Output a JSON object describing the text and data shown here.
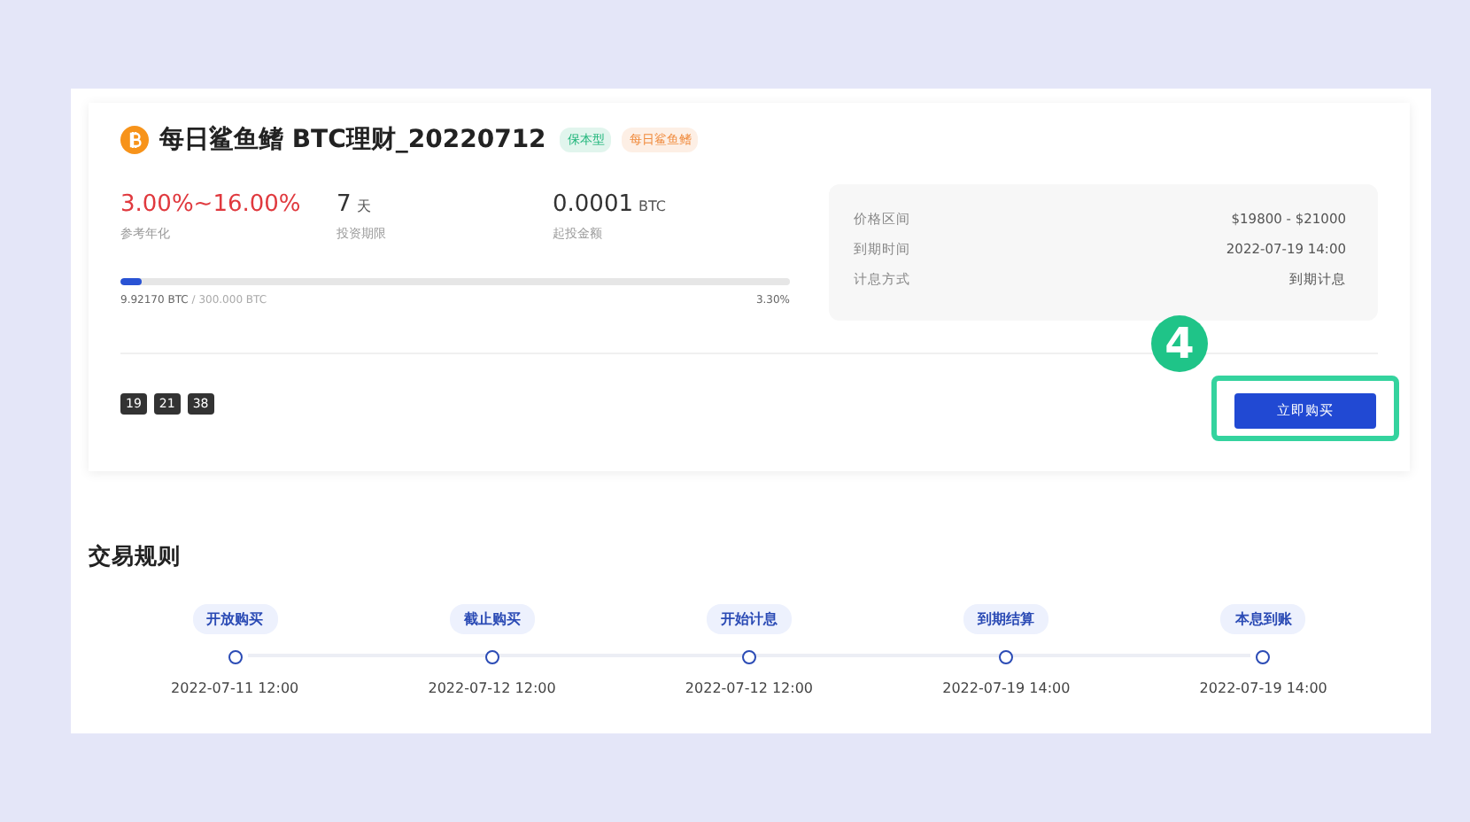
{
  "product": {
    "title": "每日鲨鱼鳍 BTC理财_20220712",
    "tags": [
      {
        "label": "保本型",
        "color": "#1fb57a"
      },
      {
        "label": "每日鲨鱼鳍",
        "color": "#f08a3c"
      }
    ],
    "stats": [
      {
        "value": "3.00%~16.00%",
        "label": "参考年化",
        "kind": "rate"
      },
      {
        "value": "7",
        "unit": "天",
        "label": "投资期限",
        "kind": "plain"
      },
      {
        "value": "0.0001",
        "unit": "BTC",
        "label": "起投金额",
        "kind": "plain"
      }
    ],
    "progress": {
      "level": 0.033,
      "amount": "9.92170 BTC",
      "total": "/ 300.000 BTC",
      "percent": "3.30%"
    },
    "details": [
      {
        "label": "价格区间",
        "value": "$19800 - $21000"
      },
      {
        "label": "到期时间",
        "value": "2022-07-19 14:00"
      },
      {
        "label": "计息方式",
        "value": "到期计息"
      }
    ],
    "countdown": [
      "19",
      "21",
      "38"
    ],
    "step_badge": "4",
    "buy_button": "立即购买"
  },
  "rules": {
    "title": "交易规则",
    "steps": [
      {
        "label": "开放购买",
        "time": "2022-07-11 12:00"
      },
      {
        "label": "截止购买",
        "time": "2022-07-12 12:00"
      },
      {
        "label": "开始计息",
        "time": "2022-07-12 12:00"
      },
      {
        "label": "到期结算",
        "time": "2022-07-19 14:00"
      },
      {
        "label": "本息到账",
        "time": "2022-07-19 14:00"
      }
    ]
  }
}
